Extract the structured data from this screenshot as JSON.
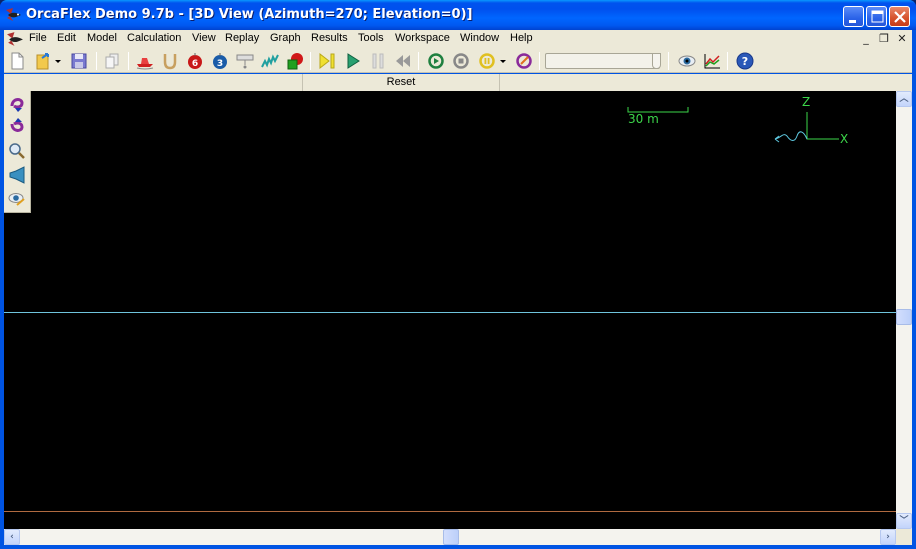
{
  "window": {
    "title": "OrcaFlex Demo 9.7b - [3D View (Azimuth=270; Elevation=0)]",
    "app_name": "OrcaFlex Demo 9.7b",
    "controls": [
      "minimize",
      "maximize",
      "close"
    ]
  },
  "menubar": {
    "items": [
      {
        "label": "File"
      },
      {
        "label": "Edit"
      },
      {
        "label": "Model"
      },
      {
        "label": "Calculation"
      },
      {
        "label": "View"
      },
      {
        "label": "Replay"
      },
      {
        "label": "Graph"
      },
      {
        "label": "Results"
      },
      {
        "label": "Tools"
      },
      {
        "label": "Workspace"
      },
      {
        "label": "Window"
      },
      {
        "label": "Help"
      }
    ],
    "mdi_controls": {
      "minimize": "_",
      "restore": "❐",
      "close": "✕"
    }
  },
  "toolbar": {
    "buttons": [
      {
        "name": "new-icon"
      },
      {
        "name": "open-icon"
      },
      {
        "name": "open-dropdown-icon"
      },
      {
        "name": "save-icon"
      },
      {
        "name": "copy-icon"
      },
      {
        "name": "new-vessel-icon"
      },
      {
        "name": "new-line-icon"
      },
      {
        "name": "new-6d-buoy-icon",
        "badge": "6"
      },
      {
        "name": "new-3d-buoy-icon",
        "badge": "3"
      },
      {
        "name": "new-winch-icon"
      },
      {
        "name": "new-link-icon"
      },
      {
        "name": "new-shape-icon"
      },
      {
        "name": "static-analysis-icon"
      },
      {
        "name": "run-simulation-icon"
      },
      {
        "name": "pause-simulation-icon"
      },
      {
        "name": "reset-icon"
      },
      {
        "name": "start-replay-icon"
      },
      {
        "name": "stop-replay-icon"
      },
      {
        "name": "pause-replay-icon"
      },
      {
        "name": "replay-dropdown-icon"
      },
      {
        "name": "replay-parameters-icon"
      },
      {
        "name": "view-parameters-icon"
      },
      {
        "name": "results-icon"
      },
      {
        "name": "help-icon"
      }
    ],
    "replay_slider": {
      "position": 1.0
    }
  },
  "status": {
    "reset_label": "Reset"
  },
  "view": {
    "azimuth": 270,
    "elevation": 0,
    "scale_bar_label": "30 m",
    "axis_labels": {
      "z": "Z",
      "x": "X"
    },
    "colors": {
      "background": "#000000",
      "sea_surface": "#6fc4dc",
      "seabed": "#b06a40",
      "axes": "#3cd64a",
      "current": "#5ec8e0"
    },
    "tools": [
      {
        "name": "rotate-up-icon"
      },
      {
        "name": "rotate-down-icon"
      },
      {
        "name": "zoom-icon"
      },
      {
        "name": "view-direction-icon"
      },
      {
        "name": "view-properties-icon"
      }
    ]
  }
}
